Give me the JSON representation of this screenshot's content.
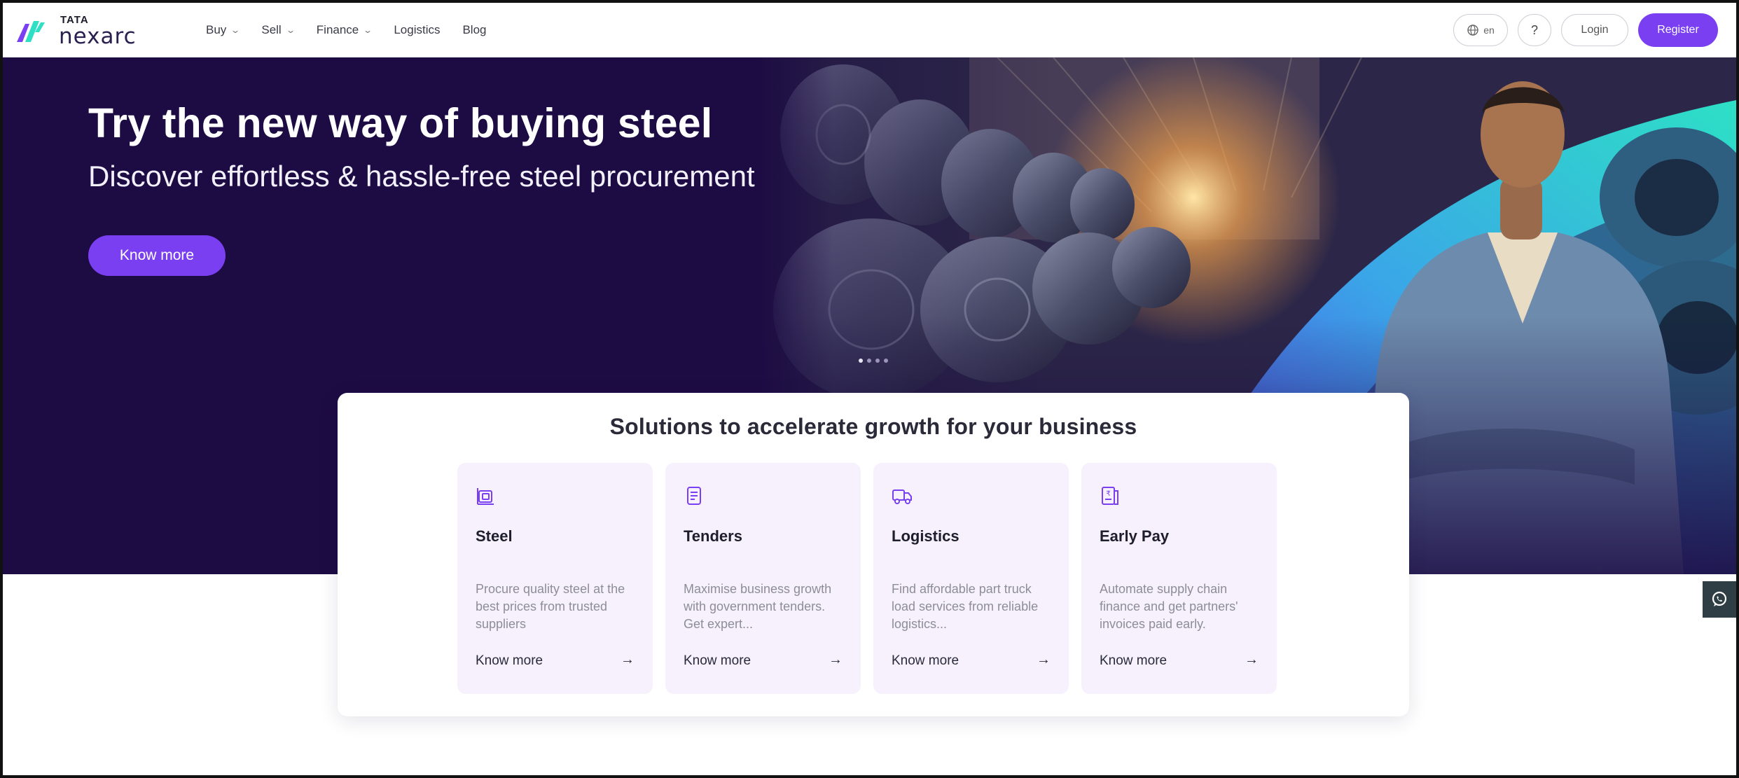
{
  "brand": {
    "tata": "TATA",
    "name": "nexarc",
    "colors": {
      "primary": "#7b3ff2",
      "hero_bg": "#1d0c44",
      "teal": "#2de0c5"
    }
  },
  "nav": {
    "items": [
      {
        "label": "Buy",
        "dropdown": true
      },
      {
        "label": "Sell",
        "dropdown": true
      },
      {
        "label": "Finance",
        "dropdown": true
      },
      {
        "label": "Logistics",
        "dropdown": false
      },
      {
        "label": "Blog",
        "dropdown": false
      }
    ]
  },
  "header": {
    "lang": "en",
    "help": "?",
    "login": "Login",
    "register": "Register",
    "lang_icon": "globe-icon"
  },
  "hero": {
    "title": "Try the new way of buying steel",
    "subtitle": "Discover effortless & hassle-free steel procurement",
    "cta": "Know more",
    "carousel_count": 4,
    "carousel_active": 1
  },
  "solutions": {
    "title": "Solutions to accelerate growth for your business",
    "tiles": [
      {
        "icon": "steel-coil-icon",
        "name": "Steel",
        "desc": "Procure quality steel at the best prices from trusted suppliers",
        "link": "Know more"
      },
      {
        "icon": "document-icon",
        "name": "Tenders",
        "desc": "Maximise business growth with government tenders. Get expert...",
        "link": "Know more"
      },
      {
        "icon": "truck-icon",
        "name": "Logistics",
        "desc": "Find affordable part truck load services from reliable logistics...",
        "link": "Know more"
      },
      {
        "icon": "invoice-icon",
        "name": "Early Pay",
        "desc": "Automate supply chain finance and get partners' invoices paid early.",
        "link": "Know more"
      }
    ]
  },
  "whatsapp": {
    "icon": "whatsapp-icon"
  }
}
